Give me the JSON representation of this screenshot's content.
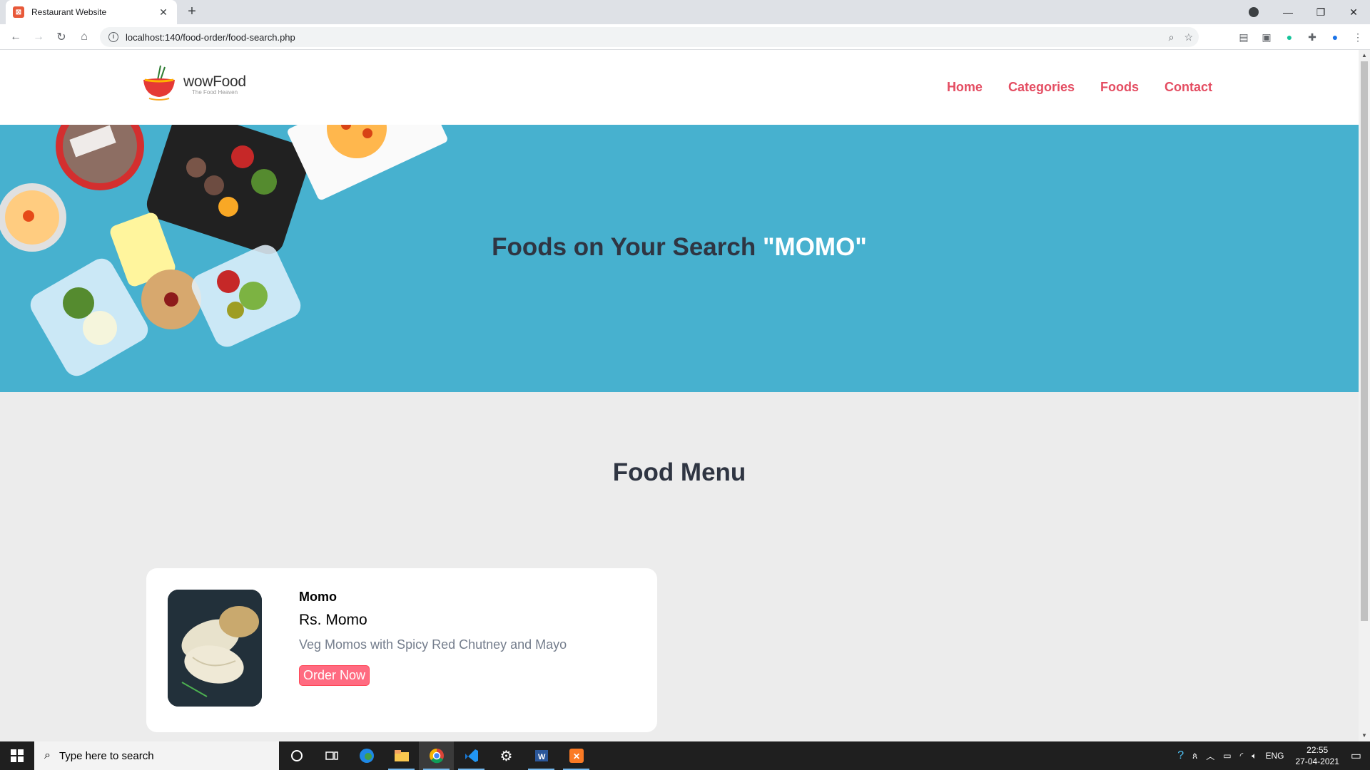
{
  "browser": {
    "tab_title": "Restaurant Website",
    "url": "localhost:140/food-order/food-search.php"
  },
  "site": {
    "logo_name": "wowFood",
    "logo_tagline": "The Food Heaven",
    "nav": [
      "Home",
      "Categories",
      "Foods",
      "Contact"
    ]
  },
  "hero": {
    "heading_prefix": "Foods on Your Search ",
    "search_term": "\"MOMO\""
  },
  "food_menu": {
    "title": "Food Menu",
    "items": [
      {
        "name": "Momo",
        "price": "Rs. Momo",
        "description": "Veg Momos with Spicy Red Chutney and Mayo",
        "button": "Order Now"
      }
    ]
  },
  "taskbar": {
    "search_placeholder": "Type here to search",
    "lang": "ENG",
    "time": "22:55",
    "date": "27-04-2021"
  }
}
